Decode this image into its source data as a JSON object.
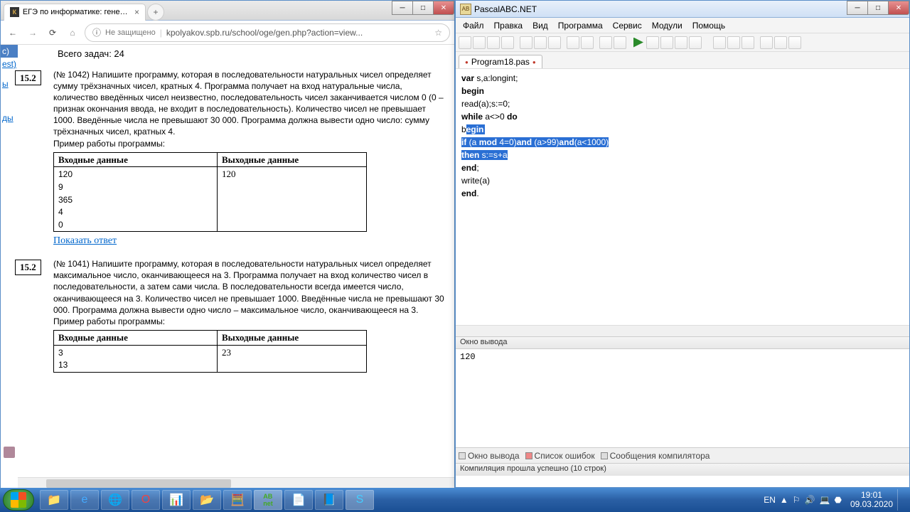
{
  "browser": {
    "tab_title": "ЕГЭ по информатике: генератор",
    "security": "Не защищено",
    "url": "kpolyakov.spb.ru/school/oge/gen.php?action=view...",
    "sidebar": [
      "с)",
      "est)",
      "ы",
      "ды"
    ],
    "header_fragment": "Всего задач: 24",
    "task1": {
      "num": "15.2",
      "id": "(№ 1042)",
      "text": "Напишите программу, которая в последовательности натуральных чисел определяет сумму трёхзначных чисел, кратных 4. Программа получает на вход натуральные числа, количество введённых чисел неизвестно, последовательность чисел заканчивается числом 0 (0 – признак окончания ввода, не входит в последовательность). Количество чисел не превышает 1000. Введённые числа не превышают 30 000. Программа должна вывести одно число: сумму трёхзначных чисел, кратных 4.",
      "example": "Пример работы программы:",
      "col1": "Входные данные",
      "col2": "Выходные данные",
      "in": [
        "120",
        "9",
        "365",
        "4",
        "0"
      ],
      "out": "120",
      "show": "Показать ответ"
    },
    "task2": {
      "num": "15.2",
      "id": "(№ 1041)",
      "text": "Напишите программу, которая в последовательности натуральных чисел определяет максимальное число, оканчивающееся на 3. Программа получает на вход количество чисел в последовательности, а затем сами числа. В последовательности всегда имеется число, оканчивающееся на 3. Количество чисел не превышает 1000. Введённые числа не превышают 30 000. Программа должна вывести одно число – максимальное число, оканчивающееся на 3. Пример работы программы:",
      "col1": "Входные данные",
      "col2": "Выходные данные",
      "in": [
        "3",
        "13"
      ],
      "out": "23"
    }
  },
  "ide": {
    "title": "PascalABC.NET",
    "menu": [
      "Файл",
      "Правка",
      "Вид",
      "Программа",
      "Сервис",
      "Модули",
      "Помощь"
    ],
    "filetab": "Program18.pas",
    "code": {
      "l1a": "var",
      "l1b": " s,a:longint;",
      "l2": "begin",
      "l3": "   read(a);s:=0;",
      "l4a": "   ",
      "l4b": "while",
      "l4c": " a<>0 ",
      "l4d": "do",
      "l5a": "   b",
      "l5b": "egin",
      "l6a": "     ",
      "l6b": "if",
      "l6c": " (a ",
      "l6d": "mod",
      "l6e": " 4=0)",
      "l6f": "and",
      "l6g": " (a>99)",
      "l6h": "and",
      "l6i": "(a<1000)",
      "l7a": "     ",
      "l7b": "then",
      "l7c": " s:=s+a",
      "l8a": "   ",
      "l8b": "end",
      "l8c": ";",
      "l9": "write(a)",
      "l10a": "end",
      "l10b": "."
    },
    "output_label": "Окно вывода",
    "output": "120",
    "tabs": [
      "Окно вывода",
      "Список ошибок",
      "Сообщения компилятора"
    ],
    "status": "Компиляция прошла успешно (10 строк)"
  },
  "taskbar": {
    "lang": "EN",
    "time": "19:01",
    "date": "09.03.2020"
  }
}
